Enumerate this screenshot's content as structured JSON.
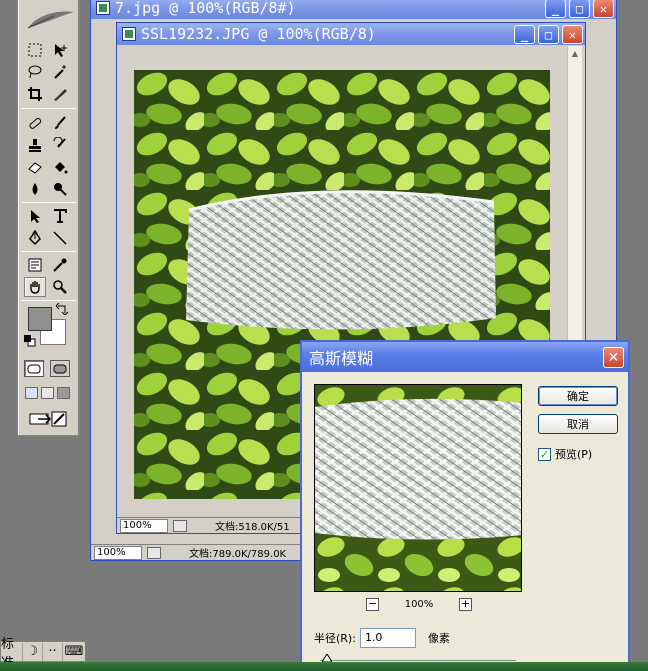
{
  "back_window": {
    "title": "7.jpg @ 100%(RGB/8#)",
    "zoom": "100%",
    "doc_size": "文档:789.0K/789.0K"
  },
  "front_window": {
    "title": "SSL19232.JPG @ 100%(RGB/8)",
    "zoom": "100%",
    "doc_size": "文档:518.0K/51"
  },
  "toolbox": {
    "tools": [
      [
        "marquee-icon",
        "move-icon"
      ],
      [
        "lasso-icon",
        "magic-wand-icon"
      ],
      [
        "crop-icon",
        "slice-icon"
      ],
      [
        "healing-brush-icon",
        "brush-icon"
      ],
      [
        "clone-stamp-icon",
        "history-brush-icon"
      ],
      [
        "eraser-icon",
        "paint-bucket-icon"
      ],
      [
        "blur-icon",
        "dodge-icon"
      ],
      [
        "path-select-icon",
        "type-icon"
      ],
      [
        "pen-icon",
        "line-icon"
      ],
      [
        "notes-icon",
        "eyedropper-icon"
      ],
      [
        "hand-icon",
        "zoom-icon"
      ]
    ],
    "foreground_color": "#8f8f8f",
    "background_color": "#ffffff"
  },
  "dialog": {
    "title": "高斯模糊",
    "ok_label": "确定",
    "cancel_label": "取消",
    "preview_label": "预览(P)",
    "preview_checked": true,
    "zoom_value": "100%",
    "zoom_minus": "−",
    "zoom_plus": "+",
    "radius_label": "半径(R):",
    "radius_value": "1.0",
    "radius_unit": "像素"
  },
  "language_bar": {
    "mode_label": "标准"
  },
  "colors": {
    "title_blue": "#7c96e8",
    "dialog_border": "#4a69d8",
    "desktop": "#7a7a7a"
  }
}
